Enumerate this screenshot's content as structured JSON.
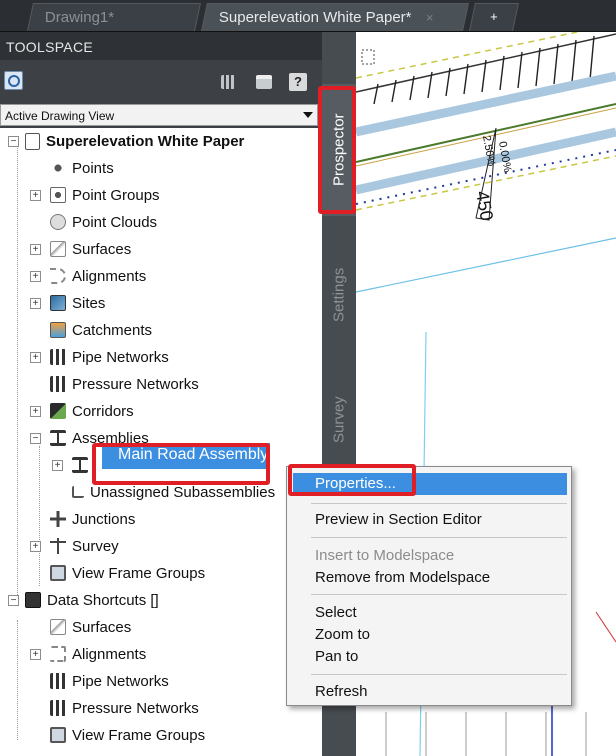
{
  "tabs": {
    "doc1": "Drawing1*",
    "doc2": "Superelevation White Paper*",
    "doc2_close": "×",
    "plus": "+"
  },
  "toolspace": {
    "title": "TOOLSPACE",
    "view": "Active Drawing View",
    "help": "?"
  },
  "side_tabs": {
    "prospector": "Prospector",
    "settings": "Settings",
    "survey": "Survey"
  },
  "tree": {
    "root": "Superelevation White Paper",
    "points": "Points",
    "point_groups": "Point Groups",
    "point_clouds": "Point Clouds",
    "surfaces": "Surfaces",
    "alignments": "Alignments",
    "sites": "Sites",
    "catchments": "Catchments",
    "pipe_networks": "Pipe Networks",
    "pressure_networks": "Pressure Networks",
    "corridors": "Corridors",
    "assemblies": "Assemblies",
    "main_road_assembly": "Main Road Assembly",
    "unassigned_subassemblies": "Unassigned Subassemblies",
    "junctions": "Junctions",
    "survey": "Survey",
    "view_frame_groups": "View Frame Groups",
    "data_shortcuts": "Data Shortcuts []",
    "ds_surfaces": "Surfaces",
    "ds_alignments": "Alignments",
    "ds_pipe_networks": "Pipe Networks",
    "ds_pressure_networks": "Pressure Networks",
    "ds_view_frame_groups": "View Frame Groups"
  },
  "context_menu": {
    "properties": "Properties...",
    "preview": "Preview in Section Editor",
    "insert": "Insert to Modelspace",
    "remove": "Remove from Modelspace",
    "select": "Select",
    "zoom": "Zoom to",
    "pan": "Pan to",
    "refresh": "Refresh"
  },
  "drawing": {
    "station": "450",
    "slope_a": "2.50%",
    "slope_b": "0.00%"
  },
  "colors": {
    "highlight": "#3c8fe0",
    "callout": "#e01e25"
  }
}
